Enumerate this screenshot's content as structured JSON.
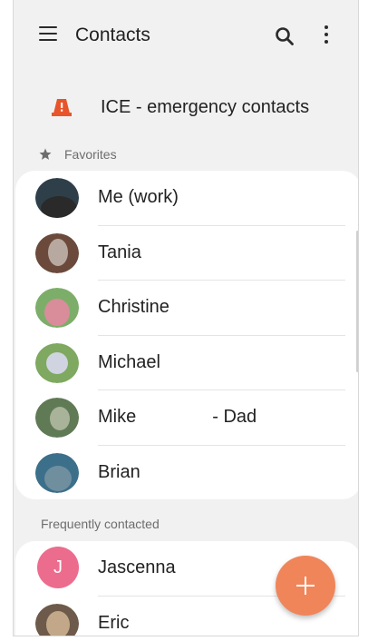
{
  "app": {
    "title": "Contacts"
  },
  "toolbar": {
    "menu_icon": "hamburger-menu-icon",
    "search_icon": "search-icon",
    "more_icon": "more-vertical-icon"
  },
  "ice": {
    "label": "ICE - emergency contacts",
    "icon": "warning-cone-icon",
    "icon_color": "#e8552b"
  },
  "favorites": {
    "label": "Favorites",
    "icon": "star-icon",
    "contacts": [
      {
        "name": "Me (work)",
        "suffix": "",
        "avatar_colors": [
          "#2f3f4a",
          "#2a2a2a"
        ]
      },
      {
        "name": "Tania",
        "suffix": "",
        "avatar_colors": [
          "#6b4a3c",
          "#b8a9a0"
        ]
      },
      {
        "name": "Christine",
        "suffix": "",
        "avatar_colors": [
          "#7cae6a",
          "#d98c9a"
        ]
      },
      {
        "name": "Michael",
        "suffix": "",
        "avatar_colors": [
          "#7fa860",
          "#cfd4e0"
        ]
      },
      {
        "name": "Mike",
        "suffix": "- Dad",
        "avatar_colors": [
          "#5f7a55",
          "#a8b39a"
        ]
      },
      {
        "name": "Brian",
        "suffix": "",
        "avatar_colors": [
          "#3c6f8a",
          "#6f8f9f"
        ]
      }
    ]
  },
  "frequently_contacted": {
    "label": "Frequently contacted",
    "contacts": [
      {
        "name": "Jascenna",
        "initial": "J",
        "avatar_color": "#ec6c8e"
      },
      {
        "name": "Eric",
        "initial": "",
        "avatar_colors": [
          "#6e5a4a",
          "#c2a888"
        ]
      }
    ]
  },
  "fab": {
    "icon": "plus-icon",
    "color": "#f0855a"
  }
}
